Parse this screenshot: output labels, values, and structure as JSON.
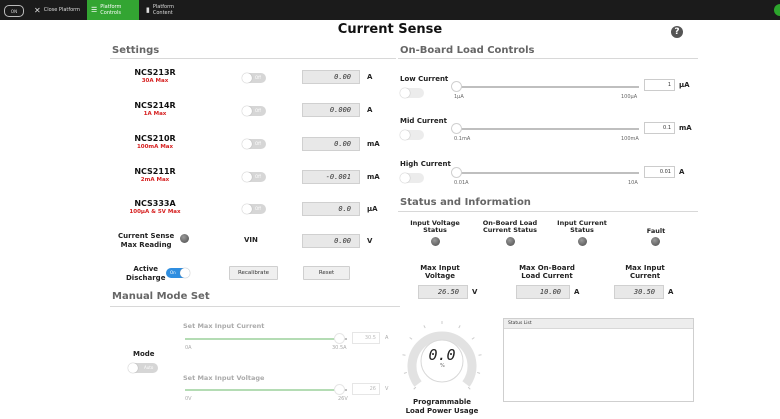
{
  "topbar": {
    "logo": "ON",
    "tabs": [
      {
        "label": "Close Platform"
      },
      {
        "label": "Platform Controls"
      },
      {
        "label": "Platform Content"
      }
    ]
  },
  "page": {
    "title": "Current Sense"
  },
  "settings": {
    "title": "Settings",
    "rows": [
      {
        "part": "NCS213R",
        "sub": "30A Max",
        "toggle": "Off",
        "value": "0.00",
        "unit": "A"
      },
      {
        "part": "NCS214R",
        "sub": "1A Max",
        "toggle": "Off",
        "value": "0.000",
        "unit": "A"
      },
      {
        "part": "NCS210R",
        "sub": "100mA Max",
        "toggle": "Off",
        "value": "0.00",
        "unit": "mA"
      },
      {
        "part": "NCS211R",
        "sub": "2mA Max",
        "toggle": "Off",
        "value": "-0.001",
        "unit": "mA"
      },
      {
        "part": "NCS333A",
        "sub": "100µA & 5V Max",
        "toggle": "Off",
        "value": "0.0",
        "unit": "µA"
      }
    ],
    "max_reading_label_1": "Current Sense",
    "max_reading_label_2": "Max Reading",
    "vin_label": "VIN",
    "vin_value": "0.00",
    "vin_unit": "V",
    "active_discharge_1": "Active",
    "active_discharge_2": "Discharge",
    "active_toggle": "On",
    "recalibrate": "Recalibrate",
    "reset": "Reset"
  },
  "manual": {
    "title": "Manual Mode Set",
    "mode_label": "Mode",
    "mode_toggle": "Auto",
    "max_current": {
      "label": "Set Max Input Current",
      "min": "0A",
      "max": "30.5A",
      "value": "30.5",
      "unit": "A",
      "fraction": 0.95
    },
    "max_voltage": {
      "label": "Set Max Input Voltage",
      "min": "0V",
      "max": "26V",
      "value": "26",
      "unit": "V",
      "fraction": 0.95
    }
  },
  "load": {
    "title": "On-Board Load Controls",
    "sliders": [
      {
        "label": "Low Current",
        "min": "1µA",
        "max": "100µA",
        "value": "1",
        "unit": "µA",
        "fraction": 0.0
      },
      {
        "label": "Mid Current",
        "min": "0.1mA",
        "max": "100mA",
        "value": "0.1",
        "unit": "mA",
        "fraction": 0.0
      },
      {
        "label": "High Current",
        "min": "0.01A",
        "max": "10A",
        "value": "0.01",
        "unit": "A",
        "fraction": 0.0
      }
    ]
  },
  "status": {
    "title": "Status and Information",
    "indicators": [
      {
        "l1": "Input Voltage",
        "l2": "Status"
      },
      {
        "l1": "On-Board Load",
        "l2": "Current Status"
      },
      {
        "l1": "Input Current",
        "l2": "Status"
      },
      {
        "l1": "Fault",
        "l2": ""
      }
    ],
    "readouts": [
      {
        "l1": "Max Input",
        "l2": "Voltage",
        "value": "26.50",
        "unit": "V"
      },
      {
        "l1": "Max On-Board",
        "l2": "Load Current",
        "value": "10.00",
        "unit": "A"
      },
      {
        "l1": "Max Input",
        "l2": "Current",
        "value": "30.50",
        "unit": "A"
      }
    ],
    "gauge": {
      "value": "0.0",
      "unit": "%",
      "caption_1": "Programmable",
      "caption_2": "Load Power Usage",
      "fraction": 0.0
    },
    "status_list_title": "Status List"
  },
  "colors": {
    "accent": "#33a532",
    "warning": "#d62020",
    "toggle_on": "#2f8ee0"
  }
}
